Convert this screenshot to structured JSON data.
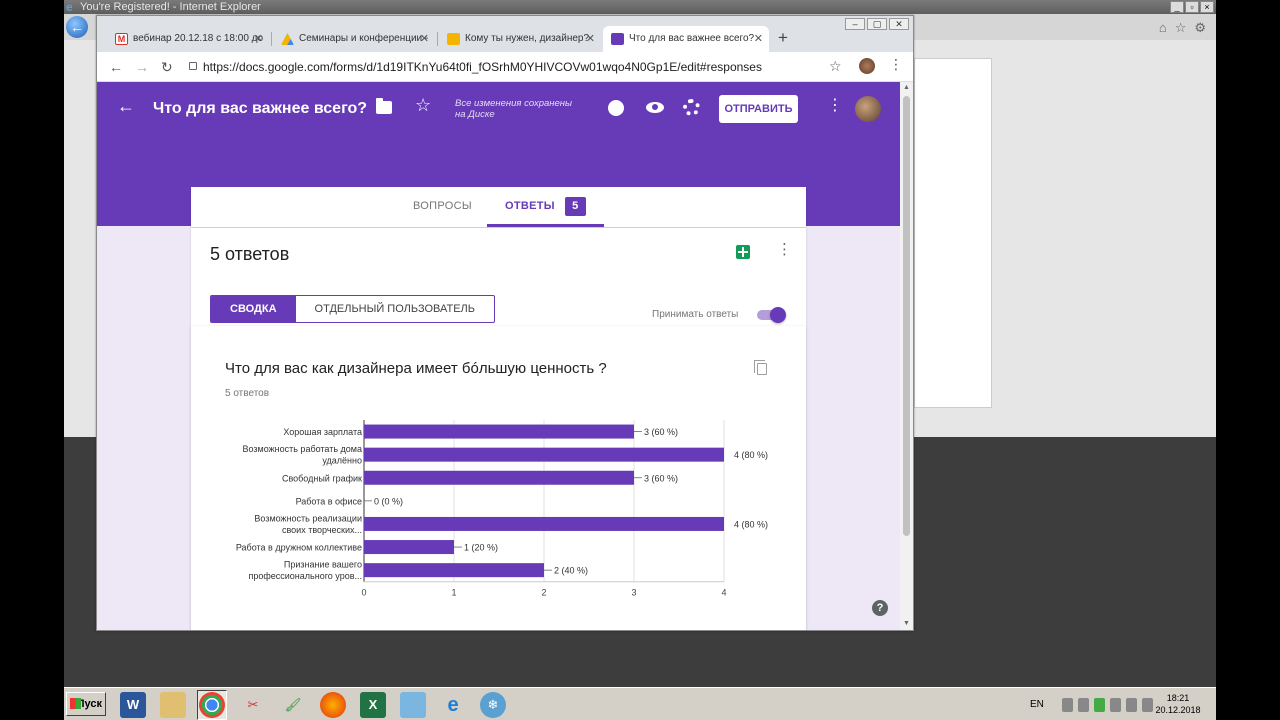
{
  "ie": {
    "title": "You're Registered! - Internet Explorer"
  },
  "chrome": {
    "tabs": [
      {
        "label": "вебинар 20.12.18 с 18:00 до",
        "icon": "gmail-icon",
        "color": "#d93025"
      },
      {
        "label": "Семинары и конференции -",
        "icon": "drive-icon",
        "color": "#1a73e8"
      },
      {
        "label": "Кому ты нужен, дизайнер?",
        "icon": "slides-icon",
        "color": "#f4b400"
      },
      {
        "label": "Что для вас важнее всего?",
        "icon": "forms-icon",
        "color": "#673ab7"
      }
    ],
    "url": "https://docs.google.com/forms/d/1d19ITKnYu64t0fi_fOSrhM0YHIVCOVw01wqo4N0Gp1E/edit#responses"
  },
  "form_header": {
    "title": "Что для вас важнее всего?",
    "saved_note": "Все изменения сохранены на Диске",
    "send_label": "ОТПРАВИТЬ"
  },
  "form_tabs": {
    "questions": "ВОПРОСЫ",
    "answers": "ОТВЕТЫ",
    "answers_count": "5"
  },
  "summary": {
    "responses_title": "5 ответов",
    "seg_summary": "СВОДКА",
    "seg_individual": "ОТДЕЛЬНЫЙ ПОЛЬЗОВАТЕЛЬ",
    "accept_label": "Принимать ответы",
    "accept_on": true
  },
  "question": {
    "title": "Что для вас как дизайнера имеет бóльшую ценность ?",
    "sub": "5 ответов"
  },
  "chart_data": {
    "type": "bar",
    "orientation": "horizontal",
    "categories": [
      [
        "Хорошая зарплата"
      ],
      [
        "Возможность работать дома",
        "удалённо"
      ],
      [
        "Свободный график"
      ],
      [
        "Работа в офисе"
      ],
      [
        "Возможность реализации",
        "своих творческих..."
      ],
      [
        "Работа в дружном коллективе"
      ],
      [
        "Признание вашего",
        "профессионального уров..."
      ]
    ],
    "values": [
      3,
      4,
      3,
      0,
      4,
      1,
      2
    ],
    "value_labels": [
      "3 (60 %)",
      "4 (80 %)",
      "3 (60 %)",
      "0 (0 %)",
      "4 (80 %)",
      "1 (20 %)",
      "2 (40 %)"
    ],
    "xticks": [
      "0",
      "1",
      "2",
      "3",
      "4"
    ],
    "xlim": [
      0,
      4
    ],
    "bar_color": "#673ab7"
  },
  "taskbar": {
    "start_label": "Пуск",
    "lang": "EN",
    "time": "18:21",
    "date": "20.12.2018"
  }
}
